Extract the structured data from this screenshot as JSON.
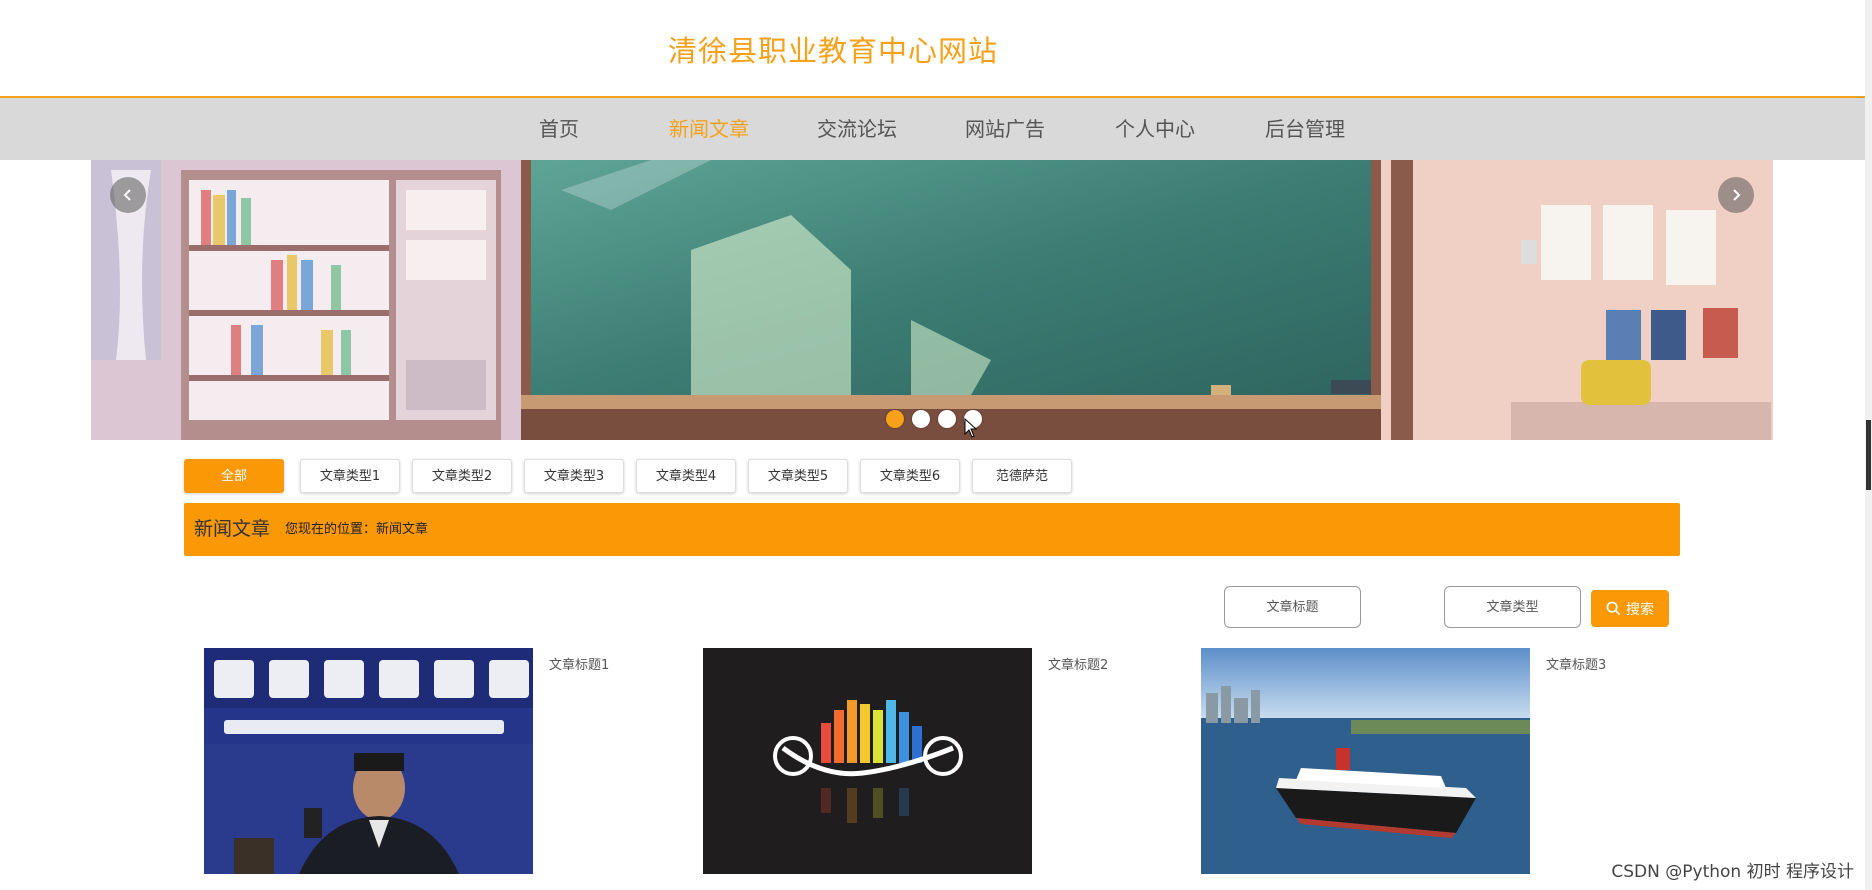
{
  "site": {
    "title": "清徐县职业教育中心网站"
  },
  "nav": [
    {
      "label": "首页"
    },
    {
      "label": "新闻文章",
      "active": true
    },
    {
      "label": "交流论坛"
    },
    {
      "label": "网站广告"
    },
    {
      "label": "个人中心"
    },
    {
      "label": "后台管理"
    }
  ],
  "carousel": {
    "slide_count": 4,
    "active_index": 0,
    "prev_icon": "chevron-left-icon",
    "next_icon": "chevron-right-icon"
  },
  "types": [
    {
      "label": "全部",
      "active": true
    },
    {
      "label": "文章类型1"
    },
    {
      "label": "文章类型2"
    },
    {
      "label": "文章类型3"
    },
    {
      "label": "文章类型4"
    },
    {
      "label": "文章类型5"
    },
    {
      "label": "文章类型6"
    },
    {
      "label": "范德萨范"
    }
  ],
  "location": {
    "title": "新闻文章",
    "text": "您现在的位置：新闻文章"
  },
  "search": {
    "title_placeholder": "文章标题",
    "type_placeholder": "文章类型",
    "button_label": "搜索",
    "icon": "search-icon"
  },
  "articles": [
    {
      "title": "文章标题1"
    },
    {
      "title": "文章标题2"
    },
    {
      "title": "文章标题3"
    }
  ],
  "colors": {
    "accent": "#fa9806",
    "title": "#f7a11a",
    "nav_bg": "#d9d9d9"
  },
  "watermark": "CSDN @Python 初时 程序设计"
}
